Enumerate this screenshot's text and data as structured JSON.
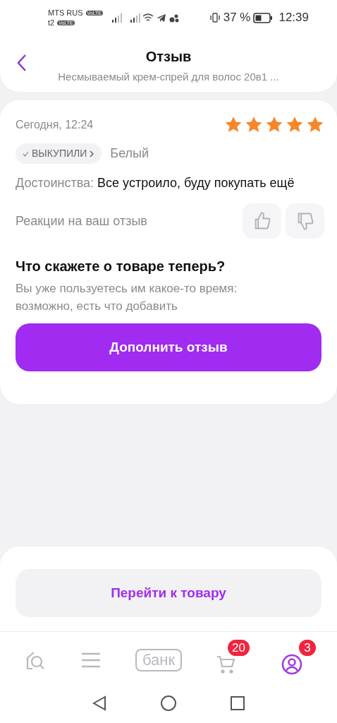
{
  "status_bar": {
    "carrier_1": "MTS RUS",
    "carrier_2": "t2",
    "volte": [
      "VoLTE",
      "VoLTE"
    ],
    "battery": "37 %",
    "time": "12:39"
  },
  "header": {
    "title": "Отзыв",
    "subtitle": "Несмываемый крем-спрей для волос 20в1 ..."
  },
  "review": {
    "date": "Сегодня, 12:24",
    "stars": 5,
    "badge": "ВЫКУПИЛИ",
    "variant": "Белый",
    "pros_label": "Достоинства:",
    "pros_text": "Все устроило, буду покупать ещё",
    "reactions_label": "Реакции на ваш отзыв",
    "prompt_title": "Что скажете о товаре теперь?",
    "prompt_text": "Вы уже пользуетесь им какое-то время: возможно, есть что добавить",
    "add_button": "Дополнить отзыв"
  },
  "go_button": "Перейти к товару",
  "nav": [
    {
      "kind": "home",
      "selected": false
    },
    {
      "kind": "catalog",
      "selected": false
    },
    {
      "kind": "bank",
      "label": "банк",
      "selected": false
    },
    {
      "kind": "cart",
      "badge": "20",
      "selected": false
    },
    {
      "kind": "profile",
      "badge": "3",
      "selected": true
    }
  ]
}
